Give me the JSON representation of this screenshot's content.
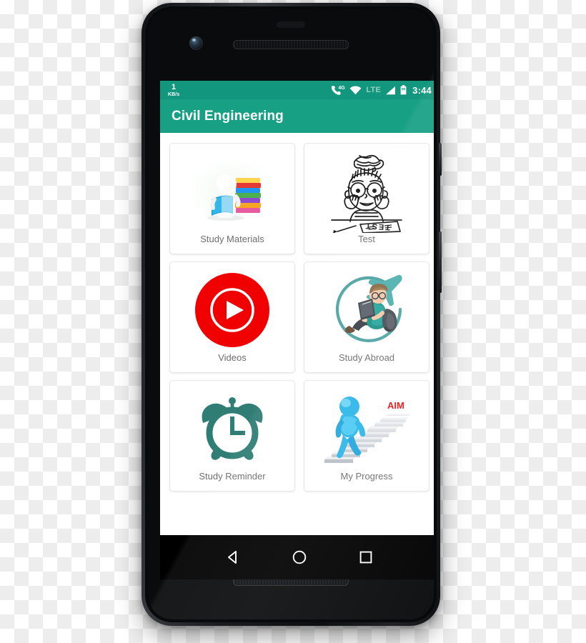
{
  "device": {
    "name": "android-phone-mockup",
    "front_camera": "front-camera",
    "earpiece": "earpiece-speaker",
    "bottom_speaker": "bottom-speaker",
    "power_button": "power-button",
    "volume_button": "volume-rocker"
  },
  "status_bar": {
    "background": "#12967d",
    "network_speed_value": "1",
    "network_speed_unit": "KB/s",
    "icons": [
      {
        "name": "call-4g-icon",
        "label": "4G"
      },
      {
        "name": "wifi-icon",
        "label": ""
      },
      {
        "name": "lte-label",
        "label": "LTE"
      },
      {
        "name": "signal-bars-icon",
        "label": ""
      },
      {
        "name": "battery-icon",
        "label": ""
      }
    ],
    "lte_text": "LTE",
    "clock": "3:44"
  },
  "app_bar": {
    "title": "Civil Engineering",
    "background": "#18a085",
    "title_color": "#ffffff"
  },
  "grid": {
    "tiles": [
      {
        "label": "Study Materials",
        "icon": "study-materials-icon"
      },
      {
        "label": "Test",
        "icon": "test-icon"
      },
      {
        "label": "Videos",
        "icon": "videos-play-icon"
      },
      {
        "label": "Study Abroad",
        "icon": "study-abroad-icon"
      },
      {
        "label": "Study Reminder",
        "icon": "alarm-clock-icon"
      },
      {
        "label": "My Progress",
        "icon": "my-progress-icon"
      }
    ],
    "label_color": "#6e6e6e",
    "card_background": "#ffffff"
  },
  "art": {
    "videos_red": "#f00000",
    "reminder_teal": "#2f7d74",
    "abroad_teal": "#4fa3a3",
    "progress_blue": "#29b6e8",
    "aim_text": "AIM",
    "test_word": "TEST"
  },
  "nav_bar": {
    "background": "#000000",
    "buttons": [
      {
        "name": "nav-back-button",
        "label": "Back"
      },
      {
        "name": "nav-home-button",
        "label": "Home"
      },
      {
        "name": "nav-recents-button",
        "label": "Recents"
      }
    ]
  }
}
